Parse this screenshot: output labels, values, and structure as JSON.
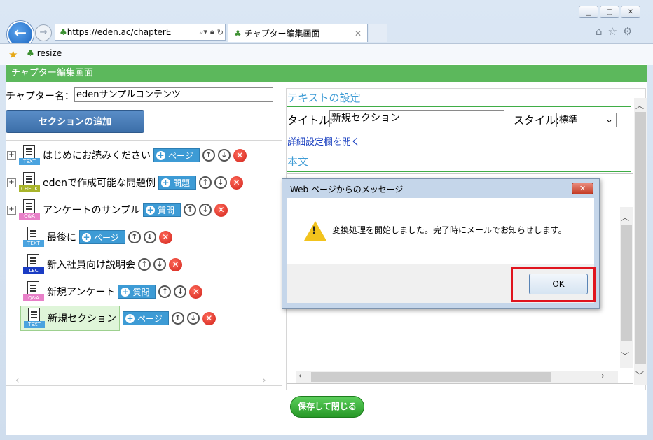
{
  "browser": {
    "window_buttons": [
      "minimize",
      "maximize",
      "close"
    ],
    "address": "https://eden.ac/chapterE",
    "tab_title": "チャプター編集画面",
    "favorite_item": "resize"
  },
  "page": {
    "header_title": "チャプター編集画面",
    "chapter_label": "チャプター名：",
    "chapter_value": "edenサンプルコンテンツ",
    "add_section_label": "セクションの追加",
    "items": [
      {
        "label": "はじめにお読みください",
        "type_tag": "TEXT",
        "type_btn": "ページ",
        "has_expander": true
      },
      {
        "label": "edenで作成可能な問題例",
        "type_tag": "CHECK",
        "type_btn": "問題",
        "has_expander": true
      },
      {
        "label": "アンケートのサンプル",
        "type_tag": "Q&A",
        "type_btn": "質問",
        "has_expander": true
      },
      {
        "label": "最後に",
        "type_tag": "TEXT",
        "type_btn": "ページ",
        "has_expander": false
      },
      {
        "label": "新入社員向け説明会",
        "type_tag": "LEC",
        "type_btn": "",
        "has_expander": false
      },
      {
        "label": "新規アンケート",
        "type_tag": "Q&A",
        "type_btn": "質問",
        "has_expander": false
      },
      {
        "label": "新規セクション",
        "type_tag": "TEXT",
        "type_btn": "ページ",
        "has_expander": false,
        "selected": true
      }
    ],
    "text_settings_heading": "テキストの設定",
    "title_label": "タイトル:",
    "title_value": "新規セクション",
    "style_label": "スタイル:",
    "style_value": "標準",
    "detail_link": "詳細設定欄を開く",
    "body_heading": "本文",
    "save_button": "保存して閉じる"
  },
  "dialog": {
    "title": "Web ページからのメッセージ",
    "message": "変換処理を開始しました。完了時にメールでお知らせします。",
    "ok_label": "OK"
  },
  "colors": {
    "header_green": "#5cb85c",
    "heading_blue": "#3d9bd5",
    "highlight_red": "#e0141e"
  }
}
